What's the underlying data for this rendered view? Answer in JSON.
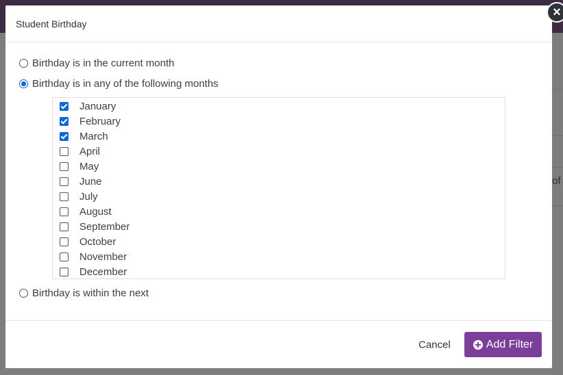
{
  "modal": {
    "title": "Student Birthday",
    "close_icon": "close-icon",
    "options": [
      {
        "label": "Birthday is in the current month",
        "selected": false
      },
      {
        "label": "Birthday is in any of the following months",
        "selected": true
      },
      {
        "label": "Birthday is within the next",
        "selected": false
      }
    ],
    "months": [
      {
        "label": "January",
        "checked": true
      },
      {
        "label": "February",
        "checked": true
      },
      {
        "label": "March",
        "checked": true
      },
      {
        "label": "April",
        "checked": false
      },
      {
        "label": "May",
        "checked": false
      },
      {
        "label": "June",
        "checked": false
      },
      {
        "label": "July",
        "checked": false
      },
      {
        "label": "August",
        "checked": false
      },
      {
        "label": "September",
        "checked": false
      },
      {
        "label": "October",
        "checked": false
      },
      {
        "label": "November",
        "checked": false
      },
      {
        "label": "December",
        "checked": false
      }
    ],
    "footer": {
      "cancel_label": "Cancel",
      "add_filter_label": "Add Filter",
      "add_filter_icon": "plus-circle-icon"
    }
  },
  "background": {
    "partial_text": "of"
  },
  "colors": {
    "accent": "#7b3f9a",
    "topbar": "#3d2a43",
    "checkbox": "#0a68d8"
  }
}
